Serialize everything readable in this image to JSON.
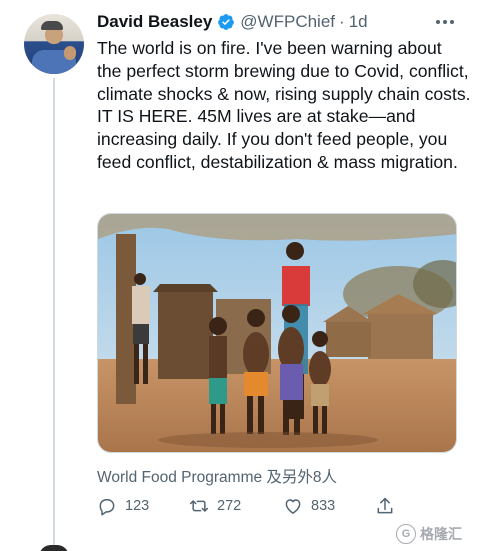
{
  "tweet": {
    "author_name": "David Beasley",
    "handle": "@WFPChief",
    "separator": "·",
    "time": "1d",
    "text": "The world is on fire. I've been warning about the perfect storm brewing due to Covid, conflict, climate shocks & now, rising supply chain costs. IT IS HERE. 45M lives are at stake—and increasing daily. If you don't feed people, you feed conflict, destabilization & mass migration.",
    "attribution": "World Food Programme 及另外8人",
    "verified": true
  },
  "actions": {
    "reply_icon": "reply-icon",
    "reply_count": "123",
    "retweet_icon": "retweet-icon",
    "retweet_count": "272",
    "like_icon": "like-icon",
    "like_count": "833",
    "share_icon": "share-icon"
  },
  "watermark": {
    "logo_text": "格隆汇"
  },
  "colors": {
    "text_primary": "#0f1419",
    "text_secondary": "#536471",
    "verified_blue": "#1d9bf0",
    "divider": "#cfd9de"
  }
}
